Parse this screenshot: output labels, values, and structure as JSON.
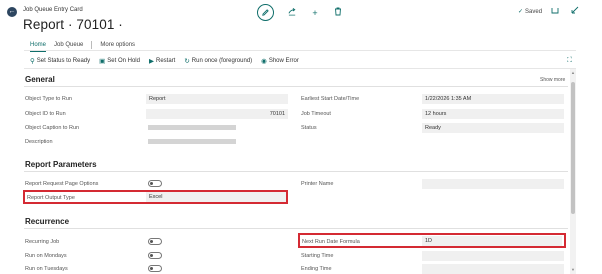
{
  "header": {
    "caption": "Job Queue Entry Card",
    "title": "Report · 70101 ·",
    "saved_label": "Saved"
  },
  "tabs": [
    "Home",
    "Job Queue",
    "More options"
  ],
  "actions": [
    {
      "label": "Set Status to Ready",
      "icon": "set-status-icon"
    },
    {
      "label": "Set On Hold",
      "icon": "hold-icon"
    },
    {
      "label": "Restart",
      "icon": "restart-icon"
    },
    {
      "label": "Run once (foreground)",
      "icon": "run-once-icon"
    },
    {
      "label": "Show Error",
      "icon": "show-error-icon"
    }
  ],
  "general": {
    "title": "General",
    "show_more": "Show more",
    "left_fields": [
      {
        "label": "Object Type to Run",
        "value": "Report"
      },
      {
        "label": "Object ID to Run",
        "value": "70101"
      },
      {
        "label": "Object Caption to Run",
        "value": ""
      },
      {
        "label": "Description",
        "value": ""
      }
    ],
    "right_fields": [
      {
        "label": "Earliest Start Date/Time",
        "value": "1/22/2026 1:35 AM"
      },
      {
        "label": "Job Timeout",
        "value": "12 hours"
      },
      {
        "label": "Status",
        "value": "Ready"
      }
    ]
  },
  "report_parameters": {
    "title": "Report Parameters",
    "request_page_label": "Report Request Page Options",
    "request_page_on": false,
    "output_type_label": "Report Output Type",
    "output_type_value": "Excel",
    "printer_label": "Printer Name",
    "printer_value": ""
  },
  "recurrence": {
    "title": "Recurrence",
    "left_fields": [
      {
        "label": "Recurring Job",
        "on": false
      },
      {
        "label": "Run on Mondays",
        "on": false
      },
      {
        "label": "Run on Tuesdays",
        "on": false
      }
    ],
    "right_fields": [
      {
        "label": "Next Run Date Formula",
        "value": "1D"
      },
      {
        "label": "Starting Time",
        "value": ""
      },
      {
        "label": "Ending Time",
        "value": ""
      }
    ]
  },
  "colors": {
    "accent": "#0f6e6a",
    "highlight": "#d42a33",
    "field_bg": "#f0f0f0"
  }
}
